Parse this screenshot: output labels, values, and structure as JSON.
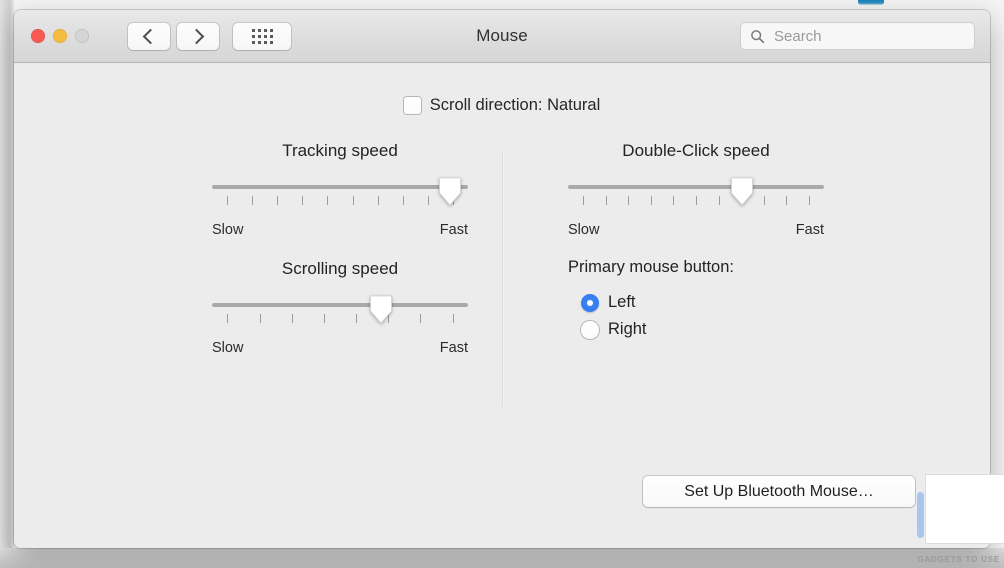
{
  "window": {
    "title": "Mouse",
    "traffic_lights": [
      {
        "name": "close",
        "color": "#f65a52"
      },
      {
        "name": "minimize",
        "color": "#f5bd3f"
      },
      {
        "name": "zoom",
        "color": "#d5d5d5"
      }
    ],
    "nav": {
      "back_icon": "chevron-left-icon",
      "forward_icon": "chevron-right-icon",
      "grid_icon": "show-all-grid-icon"
    },
    "search": {
      "icon": "search-icon",
      "value": "",
      "placeholder": "Search"
    }
  },
  "content": {
    "scroll_direction": {
      "label": "Scroll direction: Natural",
      "checked": false
    },
    "sliders": [
      {
        "id": "tracking-speed",
        "title": "Tracking speed",
        "low_label": "Slow",
        "high_label": "Fast",
        "ticks": 10,
        "value_index": 10,
        "percent": 93
      },
      {
        "id": "scrolling-speed",
        "title": "Scrolling speed",
        "low_label": "Slow",
        "high_label": "Fast",
        "ticks": 8,
        "value_index": 6,
        "percent": 66
      },
      {
        "id": "double-click-speed",
        "title": "Double-Click speed",
        "low_label": "Slow",
        "high_label": "Fast",
        "ticks": 11,
        "value_index": 7,
        "percent": 68
      }
    ],
    "primary_mouse_button": {
      "label": "Primary mouse button:",
      "options": [
        {
          "label": "Left",
          "selected": true
        },
        {
          "label": "Right",
          "selected": false
        }
      ]
    },
    "bluetooth_button": {
      "label": "Set Up Bluetooth Mouse…"
    }
  },
  "overlay": {
    "watermark": "GADGETS TO USE"
  },
  "colors": {
    "accent": "#2f76ec",
    "window_bg": "#ececec",
    "toolbar_bg": "#dedede",
    "track": "#a9a9a9"
  }
}
